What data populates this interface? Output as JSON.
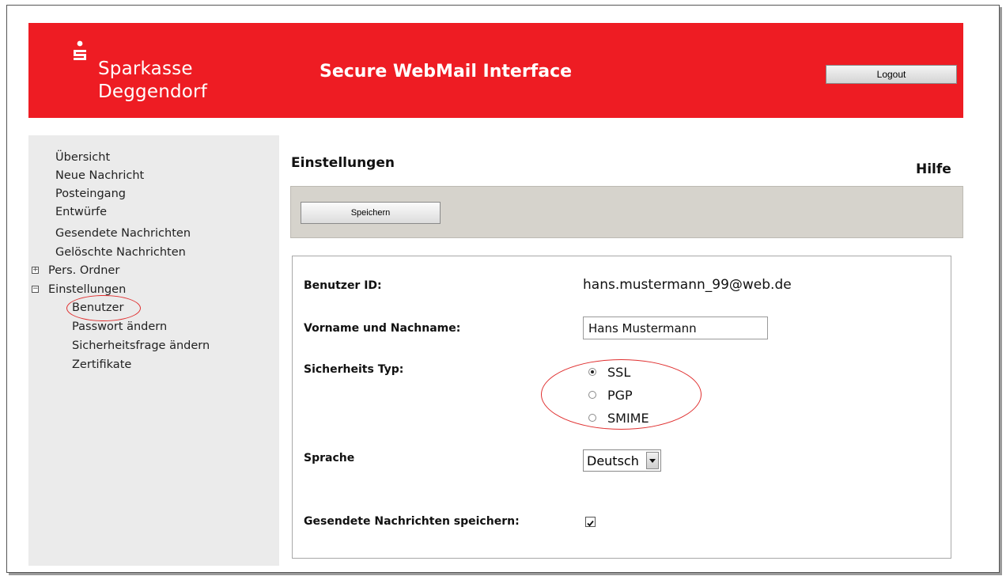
{
  "header": {
    "brand_line1": "Sparkasse",
    "brand_line2": "Deggendorf",
    "app_title": "Secure WebMail Interface",
    "logout_label": "Logout"
  },
  "colors": {
    "brand_red": "#ee1c23",
    "sidebar_bg": "#ebebeb",
    "toolbar_bg": "#d6d3cc",
    "annotation_red": "#e03030"
  },
  "sidebar": {
    "items": [
      {
        "label": "Übersicht"
      },
      {
        "label": "Neue Nachricht"
      },
      {
        "label": "Posteingang"
      },
      {
        "label": "Entwürfe"
      },
      {
        "label": "Gesendete Nachrichten"
      },
      {
        "label": "Gelöschte Nachrichten"
      }
    ],
    "tree": [
      {
        "label": "Pers. Ordner",
        "toggle": "+"
      },
      {
        "label": "Einstellungen",
        "toggle": "−"
      }
    ],
    "sub_items": [
      {
        "label": "Benutzer"
      },
      {
        "label": "Passwort ändern"
      },
      {
        "label": "Sicherheitsfrage ändern"
      },
      {
        "label": "Zertifikate"
      }
    ]
  },
  "main": {
    "page_title": "Einstellungen",
    "help_label": "Hilfe",
    "save_label": "Speichern",
    "form": {
      "user_id_label": "Benutzer ID:",
      "user_id_value": "hans.mustermann_99@web.de",
      "name_label": "Vorname und Nachname:",
      "name_value": "Hans Mustermann",
      "security_label": "Sicherheits Typ:",
      "security_options": [
        {
          "label": "SSL",
          "checked": true
        },
        {
          "label": "PGP",
          "checked": false
        },
        {
          "label": "SMIME",
          "checked": false
        }
      ],
      "language_label": "Sprache",
      "language_value": "Deutsch",
      "save_sent_label": "Gesendete Nachrichten speichern:",
      "save_sent_checked": true
    }
  }
}
